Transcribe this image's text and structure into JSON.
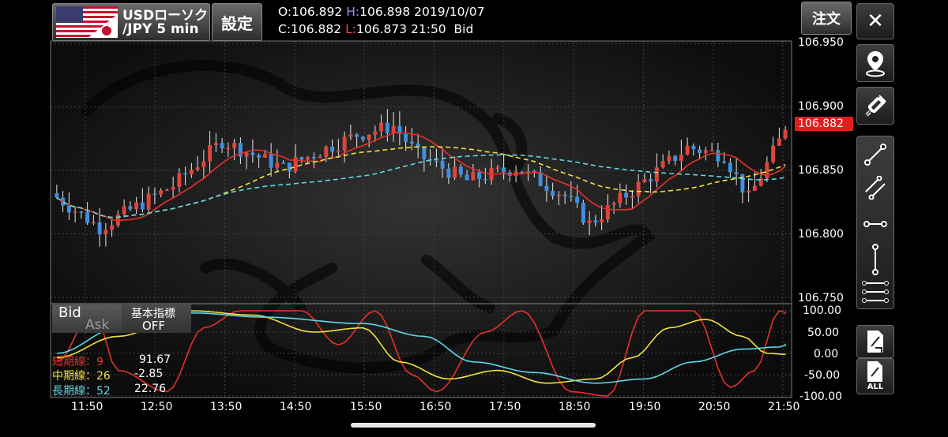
{
  "header": {
    "pair_top": "USDローソク",
    "pair_bottom": "/JPY 5 min",
    "settings_label": "設定",
    "open_label": "O:",
    "open_value": "106.892",
    "high_label": "H:",
    "high_value": "106.898",
    "date": "2019/10/07",
    "close_label": "C:",
    "close_value": "106.882",
    "low_label": "L:",
    "low_value": "106.873",
    "time": "21:50",
    "price_side": "Bid",
    "order_label": "注文"
  },
  "sidebar": {
    "close_glyph": "✕",
    "all_label": "ALL"
  },
  "price_axis": {
    "ticks": [
      "106.950",
      "106.900",
      "106.850",
      "106.800",
      "106.750"
    ],
    "current_price": "106.882"
  },
  "time_axis": {
    "ticks": [
      "11:50",
      "12:50",
      "13:50",
      "14:50",
      "15:50",
      "16:50",
      "17:50",
      "18:50",
      "19:50",
      "20:50",
      "21:50"
    ]
  },
  "oscillator_axis": {
    "ticks": [
      "100.00",
      "50.00",
      "0.00",
      "-50.00",
      "-100.00"
    ]
  },
  "bid_panel": {
    "bid_label": "Bid",
    "ask_label": "Ask",
    "indicator_label": "基本指標",
    "indicator_state": "OFF"
  },
  "legend": {
    "short": {
      "label": "短期線：9",
      "value": "91.67",
      "color": "#e8302a"
    },
    "mid": {
      "label": "中期線：26",
      "value": "-2.85",
      "color": "#f2e23a"
    },
    "long": {
      "label": "長期線：52",
      "value": "22.76",
      "color": "#5fd7e6"
    }
  },
  "colors": {
    "up_candle": "#e0443a",
    "down_candle": "#3f8fe0",
    "ma_short": "#e8302a",
    "ma_mid": "#f2e23a",
    "ma_long": "#5fd7e6"
  },
  "chart_data": {
    "type": "candlestick",
    "y_range": [
      106.745,
      106.95
    ],
    "y_ticks": [
      106.75,
      106.8,
      106.85,
      106.9,
      106.95
    ],
    "time_range": [
      "11:50",
      "21:50"
    ],
    "last": {
      "open": 106.892,
      "high": 106.898,
      "low": 106.873,
      "close": 106.882
    },
    "oscillator_range": [
      -100,
      100
    ],
    "oscillator_ticks": [
      100,
      50,
      0,
      -50,
      -100
    ],
    "ma_series": [
      {
        "name": "短期線：9",
        "last": 91.67
      },
      {
        "name": "中期線：26",
        "last": -2.85
      },
      {
        "name": "長期線：52",
        "last": 22.76
      }
    ]
  }
}
